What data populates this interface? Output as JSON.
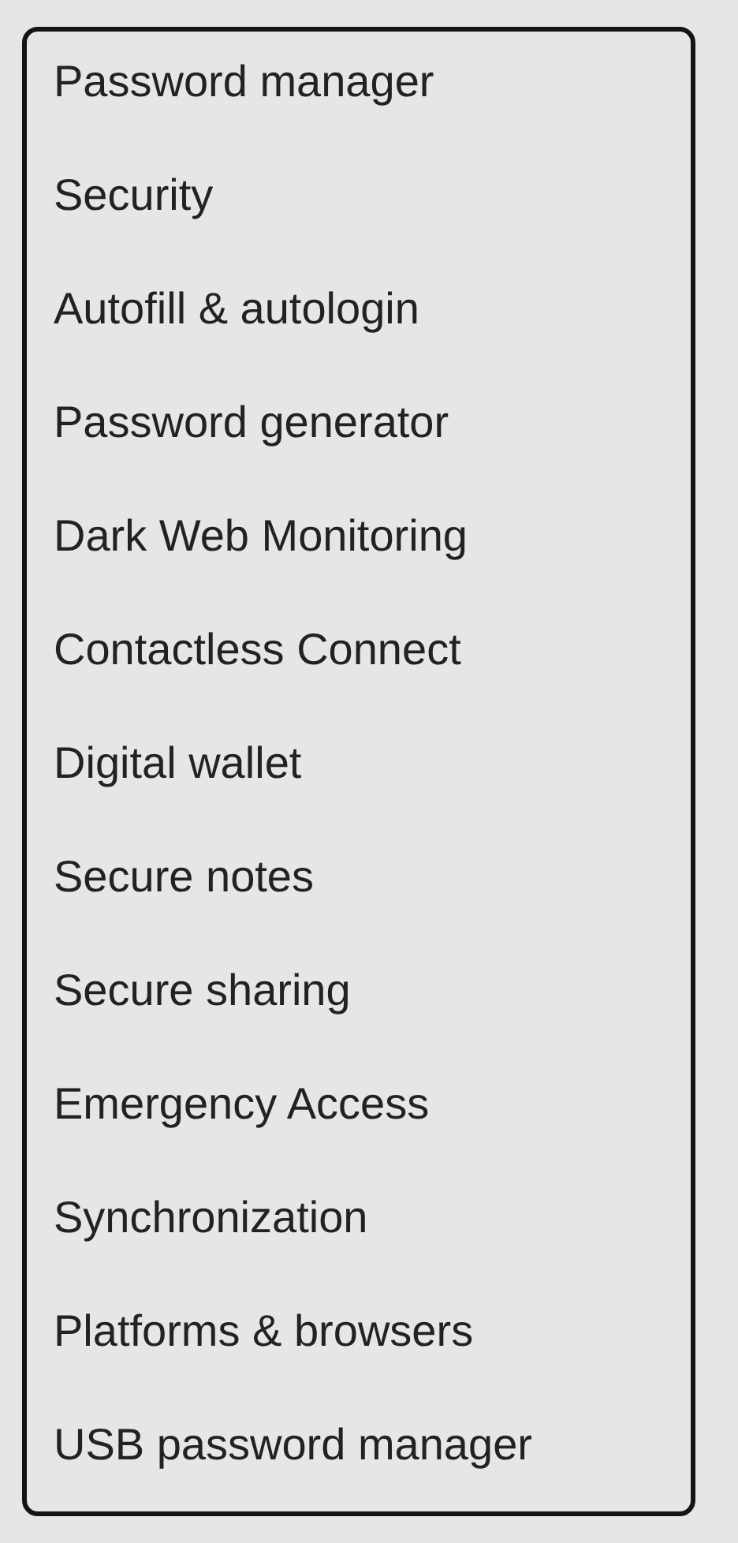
{
  "menu": {
    "items": [
      {
        "label": "Password manager"
      },
      {
        "label": "Security"
      },
      {
        "label": "Autofill & autologin"
      },
      {
        "label": "Password generator"
      },
      {
        "label": "Dark Web Monitoring"
      },
      {
        "label": "Contactless Connect"
      },
      {
        "label": "Digital wallet"
      },
      {
        "label": "Secure notes"
      },
      {
        "label": "Secure sharing"
      },
      {
        "label": "Emergency Access"
      },
      {
        "label": "Synchronization"
      },
      {
        "label": "Platforms & browsers"
      },
      {
        "label": "USB password manager"
      }
    ]
  }
}
